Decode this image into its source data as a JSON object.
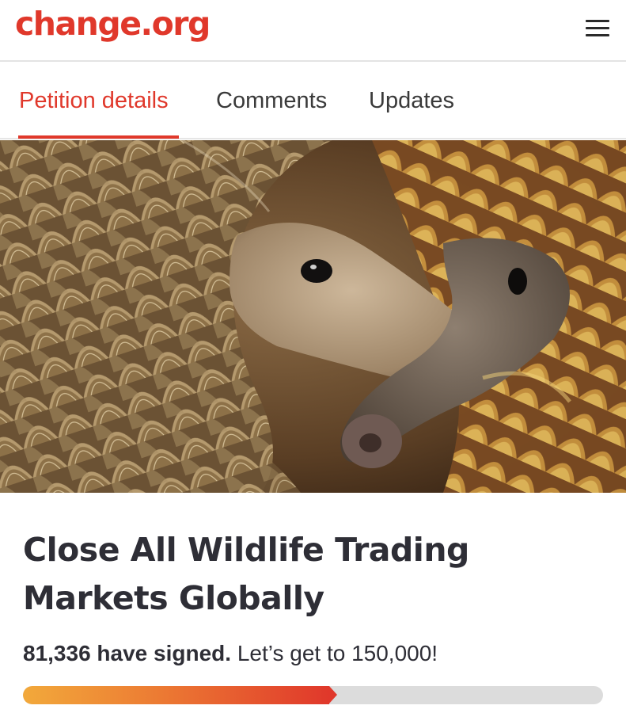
{
  "header": {
    "logo_text": "change.org",
    "menu_icon": "hamburger-menu-icon",
    "brand_color": "#e0382b"
  },
  "tabs": [
    {
      "label": "Petition details",
      "active": true
    },
    {
      "label": "Comments",
      "active": false
    },
    {
      "label": "Updates",
      "active": false
    }
  ],
  "hero_image": {
    "subject": "pangolins"
  },
  "petition": {
    "title": "Close All Wildlife Trading Markets Globally",
    "signed_count_text": "81,336 have signed.",
    "goal_text": "Let’s get to 150,000!",
    "signed": 81336,
    "goal": 150000,
    "progress_fraction": 0.542
  }
}
